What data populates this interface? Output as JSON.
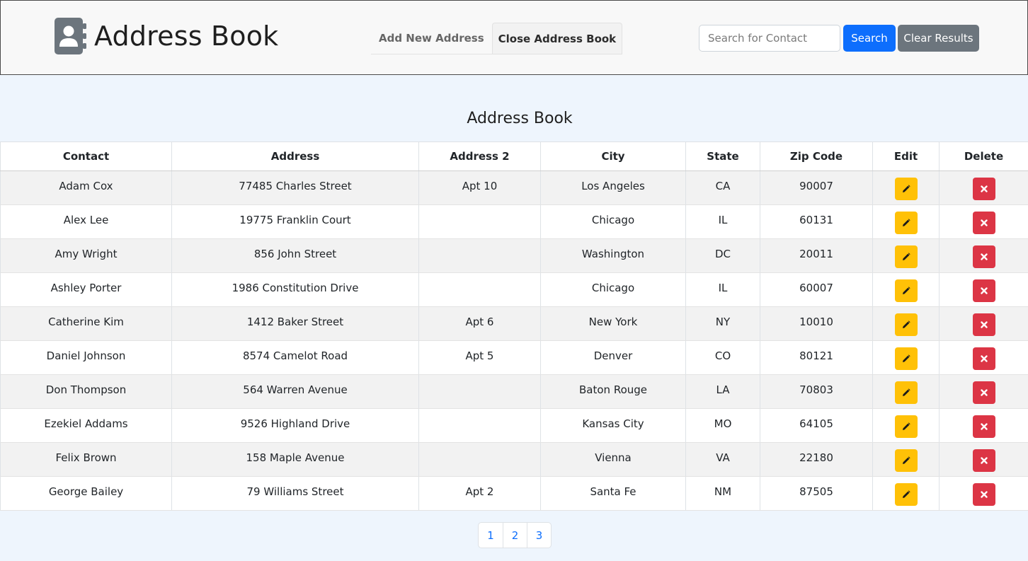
{
  "brand": {
    "title": "Address Book",
    "icon": "address-book-icon"
  },
  "nav": {
    "tabs": [
      {
        "label": "Add New Address",
        "active": false
      },
      {
        "label": "Close Address Book",
        "active": true
      }
    ]
  },
  "search": {
    "placeholder": "Search for Contact",
    "value": "",
    "search_label": "Search",
    "clear_label": "Clear Results"
  },
  "main": {
    "title": "Address Book",
    "columns": [
      "Contact",
      "Address",
      "Address 2",
      "City",
      "State",
      "Zip Code",
      "Edit",
      "Delete"
    ],
    "rows": [
      {
        "contact": "Adam Cox",
        "address": "77485 Charles Street",
        "address2": "Apt 10",
        "city": "Los Angeles",
        "state": "CA",
        "zip": "90007"
      },
      {
        "contact": "Alex Lee",
        "address": "19775 Franklin Court",
        "address2": "",
        "city": "Chicago",
        "state": "IL",
        "zip": "60131"
      },
      {
        "contact": "Amy Wright",
        "address": "856 John Street",
        "address2": "",
        "city": "Washington",
        "state": "DC",
        "zip": "20011"
      },
      {
        "contact": "Ashley Porter",
        "address": "1986 Constitution Drive",
        "address2": "",
        "city": "Chicago",
        "state": "IL",
        "zip": "60007"
      },
      {
        "contact": "Catherine Kim",
        "address": "1412 Baker Street",
        "address2": "Apt 6",
        "city": "New York",
        "state": "NY",
        "zip": "10010"
      },
      {
        "contact": "Daniel Johnson",
        "address": "8574 Camelot Road",
        "address2": "Apt 5",
        "city": "Denver",
        "state": "CO",
        "zip": "80121"
      },
      {
        "contact": "Don Thompson",
        "address": "564 Warren Avenue",
        "address2": "",
        "city": "Baton Rouge",
        "state": "LA",
        "zip": "70803"
      },
      {
        "contact": "Ezekiel Addams",
        "address": "9526 Highland Drive",
        "address2": "",
        "city": "Kansas City",
        "state": "MO",
        "zip": "64105"
      },
      {
        "contact": "Felix Brown",
        "address": "158 Maple Avenue",
        "address2": "",
        "city": "Vienna",
        "state": "VA",
        "zip": "22180"
      },
      {
        "contact": "George Bailey",
        "address": "79 Williams Street",
        "address2": "Apt 2",
        "city": "Santa Fe",
        "state": "NM",
        "zip": "87505"
      }
    ],
    "row_icons": {
      "edit": "pencil-icon",
      "delete": "close-icon"
    }
  },
  "pagination": {
    "pages": [
      "1",
      "2",
      "3"
    ]
  },
  "colors": {
    "primary": "#0d6efd",
    "secondary": "#6c757d",
    "warning": "#ffc107",
    "danger": "#dc3545",
    "page_bg": "#eef5fd"
  }
}
